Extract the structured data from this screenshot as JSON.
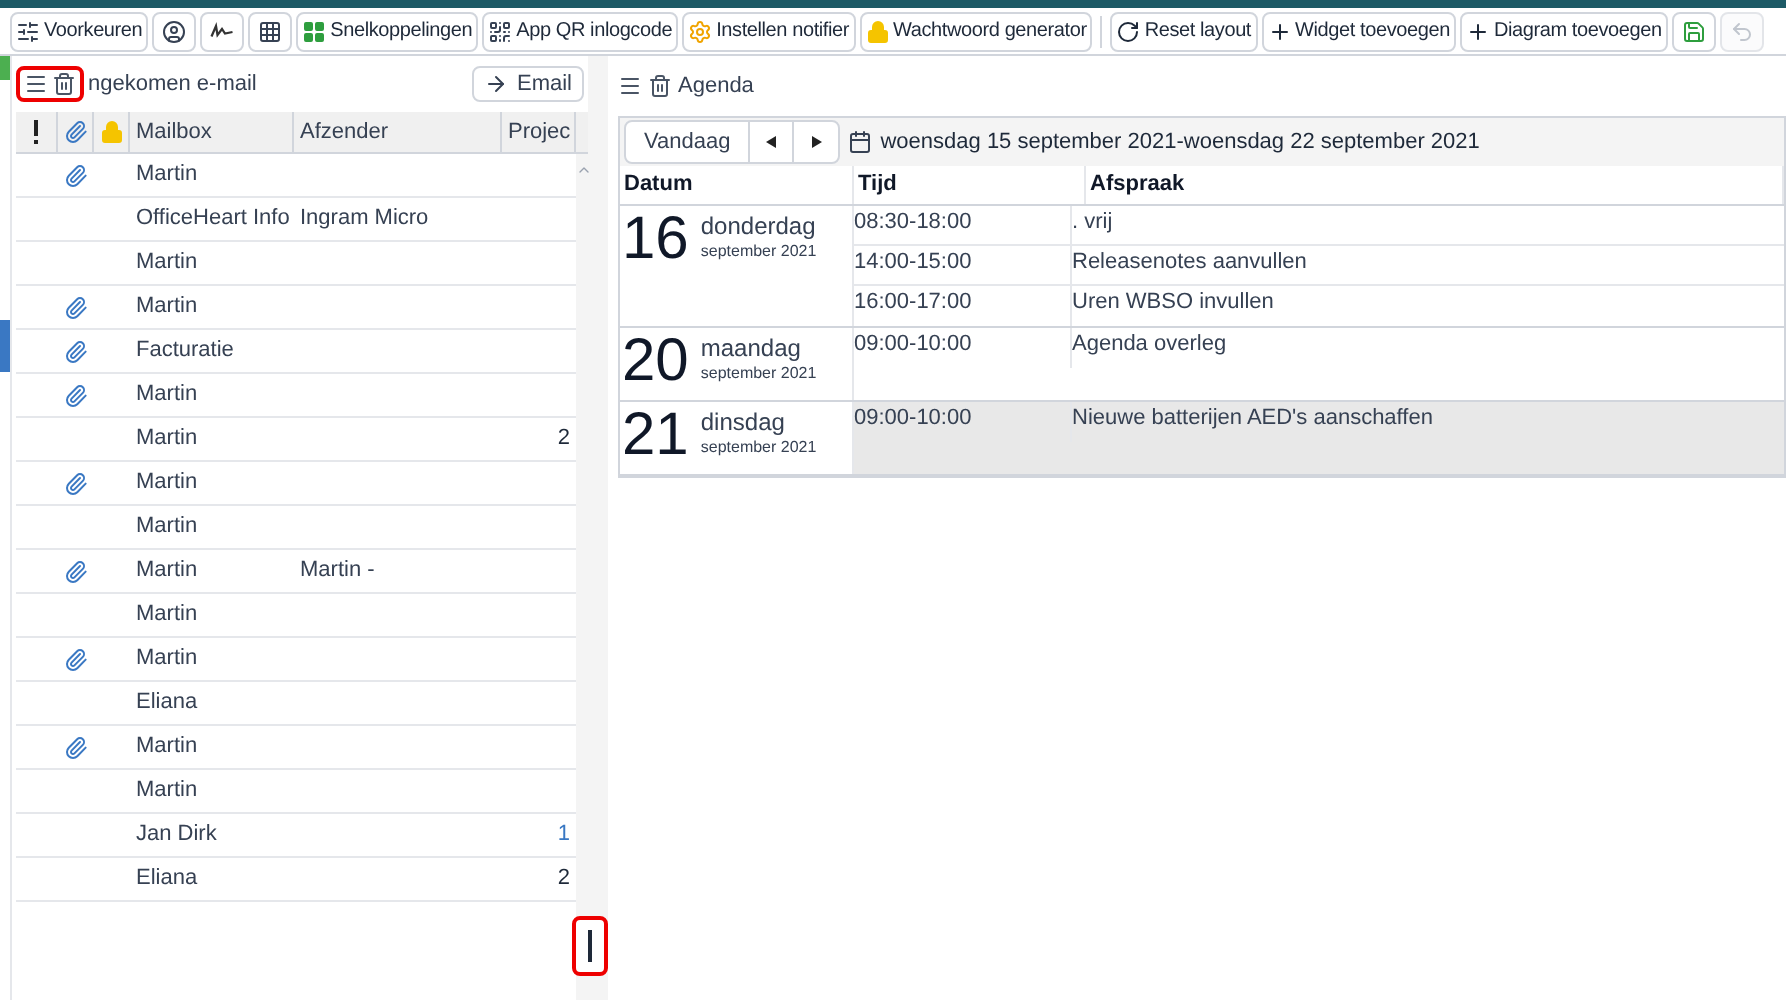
{
  "toolbar": [
    {
      "kind": "icon-text",
      "label": "Voorkeuren"
    },
    {
      "kind": "icon"
    },
    {
      "kind": "icon"
    },
    {
      "kind": "icon"
    },
    {
      "kind": "icon-text",
      "label": "Snelkoppelingen"
    },
    {
      "kind": "icon-text",
      "label": "App QR inlogcode"
    },
    {
      "kind": "icon-text",
      "label": "Instellen notifier"
    },
    {
      "kind": "icon-text",
      "label": "Wachtwoord generator"
    },
    {
      "kind": "separator"
    },
    {
      "kind": "icon-text",
      "label": "Reset layout"
    },
    {
      "kind": "icon-text",
      "label": "Widget toevoegen"
    },
    {
      "kind": "icon-text",
      "label": "Diagram toevoegen"
    },
    {
      "kind": "icon"
    },
    {
      "kind": "icon",
      "disabled": true
    }
  ],
  "email_panel": {
    "title": "ngekomen e-mail",
    "button": "Email",
    "columns": [
      {
        "kind": "icon"
      },
      {
        "kind": "icon"
      },
      {
        "kind": "icon"
      },
      {
        "kind": "text",
        "label": "Mailbox"
      },
      {
        "kind": "text",
        "label": "Afzender"
      },
      {
        "kind": "text",
        "label": "Projec"
      }
    ],
    "rows": [
      {
        "attachment": true,
        "mailbox": "Martin"
      },
      {
        "attachment": false,
        "mailbox": "OfficeHeart Info",
        "sender": "Ingram Micro"
      },
      {
        "attachment": false,
        "mailbox": "Martin"
      },
      {
        "attachment": true,
        "mailbox": "Martin"
      },
      {
        "attachment": true,
        "mailbox": "Facturatie"
      },
      {
        "attachment": true,
        "mailbox": "Martin"
      },
      {
        "attachment": false,
        "mailbox": "Martin",
        "project": "2",
        "link": false
      },
      {
        "attachment": true,
        "mailbox": "Martin"
      },
      {
        "attachment": false,
        "mailbox": "Martin"
      },
      {
        "attachment": true,
        "mailbox": "Martin",
        "sender": "Martin -"
      },
      {
        "attachment": false,
        "mailbox": "Martin"
      },
      {
        "attachment": true,
        "mailbox": "Martin"
      },
      {
        "attachment": false,
        "mailbox": "Eliana"
      },
      {
        "attachment": true,
        "mailbox": "Martin"
      },
      {
        "attachment": false,
        "mailbox": "Martin"
      },
      {
        "attachment": false,
        "mailbox": "Jan Dirk",
        "project": "1",
        "link": true
      },
      {
        "attachment": false,
        "mailbox": "Eliana",
        "project": "2",
        "link": false
      }
    ]
  },
  "agenda_panel": {
    "title": "Agenda",
    "today_button": "Vandaag",
    "range": "woensdag 15 september 2021-woensdag 22 september 2021",
    "columns": [
      "Datum",
      "Tijd",
      "Afspraak"
    ],
    "days": [
      {
        "day": "16",
        "weekday": "donderdag",
        "month": "september 2021",
        "selected": false,
        "items": [
          {
            "time": "08:30-18:00",
            "text": ". vrij"
          },
          {
            "time": "14:00-15:00",
            "text": "Releasenotes aanvullen"
          },
          {
            "time": "16:00-17:00",
            "text": "Uren WBSO invullen"
          }
        ]
      },
      {
        "day": "20",
        "weekday": "maandag",
        "month": "september 2021",
        "selected": false,
        "items": [
          {
            "time": "09:00-10:00",
            "text": "Agenda overleg"
          }
        ]
      },
      {
        "day": "21",
        "weekday": "dinsdag",
        "month": "september 2021",
        "selected": true,
        "items": [
          {
            "time": "09:00-10:00",
            "text": "Nieuwe batterijen AED's aanschaffen"
          }
        ]
      }
    ]
  }
}
